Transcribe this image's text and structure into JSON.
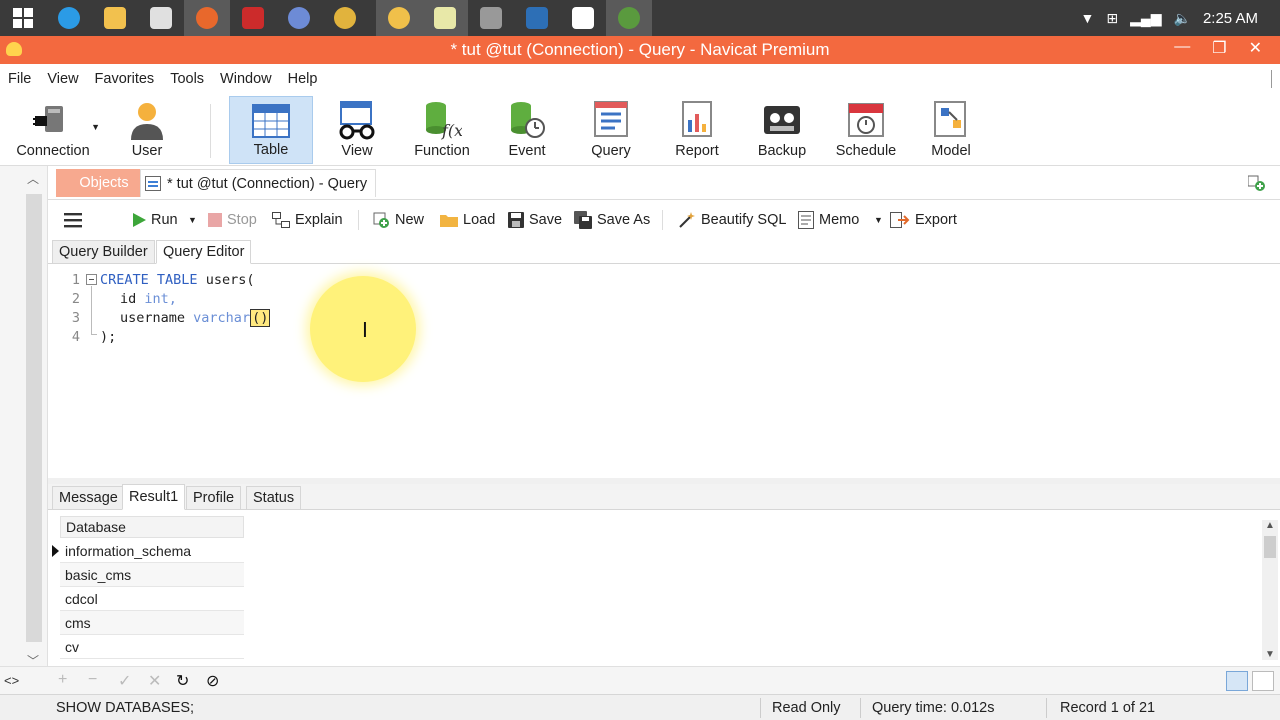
{
  "window": {
    "title": "* tut @tut (Connection) - Query - Navicat Premium"
  },
  "taskbar": {
    "time": "2:25 AM",
    "apps": [
      {
        "icon": "windows-start-icon",
        "color": "#ffffff"
      },
      {
        "icon": "internet-explorer-icon",
        "color": "#2b9be6"
      },
      {
        "icon": "file-explorer-icon",
        "color": "#f2c14e"
      },
      {
        "icon": "pinwheel-app-icon",
        "color": "#ffffff"
      },
      {
        "icon": "firefox-icon",
        "color": "#e8682c"
      },
      {
        "icon": "red-app-icon",
        "color": "#cc2b2b"
      },
      {
        "icon": "globe-app-icon",
        "color": "#6d8bd6"
      },
      {
        "icon": "chrome-icon",
        "color": "#e1b33d"
      },
      {
        "icon": "navicat-icon",
        "color": "#f0c04a"
      },
      {
        "icon": "notepad-icon",
        "color": "#e8e8a8"
      },
      {
        "icon": "terminal-icon",
        "color": "#999999"
      },
      {
        "icon": "powershell-icon",
        "color": "#2d6fb6"
      },
      {
        "icon": "c-app-icon",
        "color": "#ffffff"
      },
      {
        "icon": "earth-app-icon",
        "color": "#5a9a3e"
      }
    ]
  },
  "menu": [
    "File",
    "View",
    "Favorites",
    "Tools",
    "Window",
    "Help"
  ],
  "ribbon": {
    "connection": "Connection",
    "user": "User",
    "items": [
      "Table",
      "View",
      "Function",
      "Event",
      "Query",
      "Report",
      "Backup",
      "Schedule",
      "Model"
    ],
    "active": "Table"
  },
  "tabs": {
    "objects": "Objects",
    "query_tab": "* tut @tut (Connection) - Query"
  },
  "toolbar": {
    "run": "Run",
    "stop": "Stop",
    "explain": "Explain",
    "new": "New",
    "load": "Load",
    "save": "Save",
    "save_as": "Save As",
    "beautify": "Beautify SQL",
    "memo": "Memo",
    "export": "Export"
  },
  "subtabs": [
    "Query Builder",
    "Query Editor"
  ],
  "editor": {
    "line_numbers": [
      "1",
      "2",
      "3",
      "4"
    ],
    "kw_create": "CREATE",
    "kw_table": "TABLE",
    "table_name": "users(",
    "col1": "id",
    "col1_type": "int,",
    "col2": "username",
    "col2_type": "varchar",
    "cursor_text": "()",
    "closing": ");"
  },
  "result_tabs": [
    "Message",
    "Result1",
    "Profile",
    "Status"
  ],
  "result": {
    "column": "Database",
    "rows": [
      "information_schema",
      "basic_cms",
      "cdcol",
      "cms",
      "cv"
    ]
  },
  "statusbar": {
    "sql": "SHOW DATABASES;",
    "mode": "Read Only",
    "query_time": "Query time: 0.012s",
    "record": "Record 1 of 21"
  },
  "colors": {
    "titlebar": "#f3693f",
    "objects_tab": "#f7a98f",
    "active_ribbon": "#cfe3f7",
    "keyword": "#2f5fc1"
  }
}
